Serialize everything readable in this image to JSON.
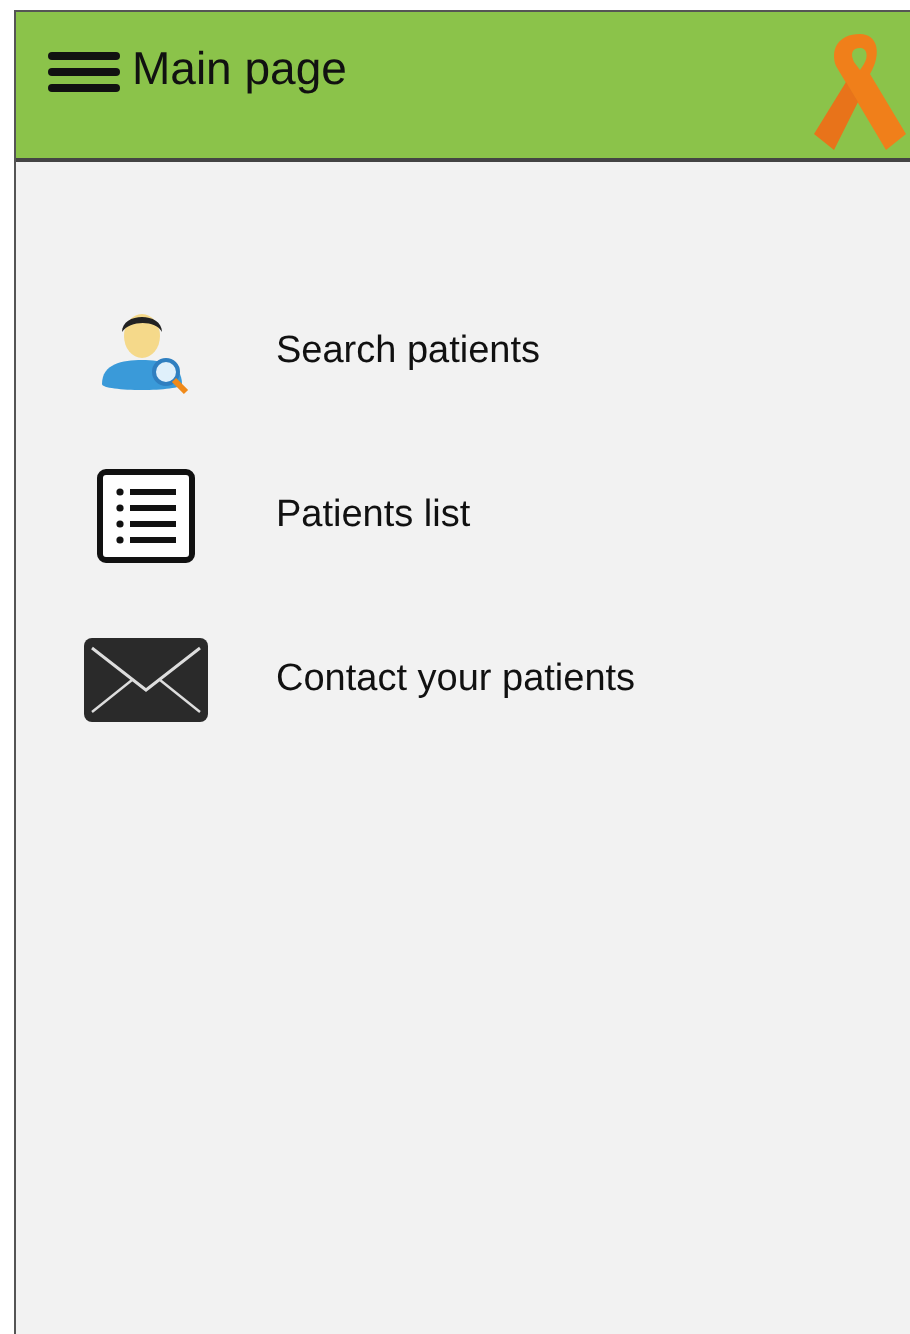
{
  "header": {
    "title": "Main page"
  },
  "menu": [
    {
      "kind": "search",
      "label": "Search patients"
    },
    {
      "kind": "list",
      "label": "Patients list"
    },
    {
      "kind": "mail",
      "label": "Contact your patients"
    }
  ]
}
